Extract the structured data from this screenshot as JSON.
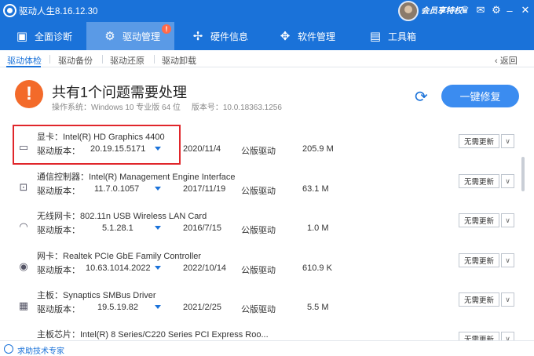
{
  "window": {
    "title": "驱动人生8.16.12.30",
    "vip_label": "会员享特权"
  },
  "nav": {
    "tabs": [
      {
        "label": "全面诊断",
        "icon": "monitor-icon"
      },
      {
        "label": "驱动管理",
        "icon": "gear-icon",
        "active": true,
        "badge": "!"
      },
      {
        "label": "硬件信息",
        "icon": "fan-icon"
      },
      {
        "label": "软件管理",
        "icon": "apps-icon"
      },
      {
        "label": "工具箱",
        "icon": "toolbox-icon"
      }
    ]
  },
  "subnav": {
    "items": [
      "驱动体检",
      "驱动备份",
      "驱动还原",
      "驱动卸载"
    ],
    "active": "驱动体检",
    "back_label": "返回"
  },
  "summary": {
    "headline": "共有1个问题需要处理",
    "os_info": "操作系统：Windows 10 专业版 64 位",
    "version_info": "版本号：10.0.18363.1256",
    "fix_button": "一键修复"
  },
  "drivers": [
    {
      "category": "显卡：",
      "name": "Intel(R) HD Graphics 4400",
      "version_label": "驱动版本：",
      "version": "20.19.15.5171",
      "date": "2020/11/4",
      "type": "公版驱动",
      "size": "205.9 M",
      "action": "无需更新",
      "icon": "display-card-icon"
    },
    {
      "category": "通信控制器：",
      "name": "Intel(R) Management Engine Interface",
      "version_label": "驱动版本：",
      "version": "11.7.0.1057",
      "date": "2017/11/19",
      "type": "公版驱动",
      "size": "63.1 M",
      "action": "无需更新",
      "icon": "chip-icon"
    },
    {
      "category": "无线网卡：",
      "name": "802.11n USB Wireless LAN Card",
      "version_label": "驱动版本：",
      "version": "5.1.28.1",
      "date": "2016/7/15",
      "type": "公版驱动",
      "size": "1.0 M",
      "action": "无需更新",
      "icon": "wifi-icon"
    },
    {
      "category": "网卡：",
      "name": "Realtek PCIe GbE Family Controller",
      "version_label": "驱动版本：",
      "version": "10.63.1014.2022",
      "date": "2022/10/14",
      "type": "公版驱动",
      "size": "610.9 K",
      "action": "无需更新",
      "icon": "network-card-icon"
    },
    {
      "category": "主板：",
      "name": "Synaptics SMBus Driver",
      "version_label": "驱动版本：",
      "version": "19.5.19.82",
      "date": "2021/2/25",
      "type": "公版驱动",
      "size": "5.5 M",
      "action": "无需更新",
      "icon": "motherboard-icon"
    },
    {
      "category": "主板芯片：",
      "name": "Intel(R) 8 Series/C220 Series PCI Express Roo...",
      "version_label": "",
      "version": "",
      "date": "",
      "type": "",
      "size": "",
      "action": "无需更新",
      "icon": "chipset-icon"
    }
  ],
  "footer": {
    "help_text": "求助技术专家"
  }
}
